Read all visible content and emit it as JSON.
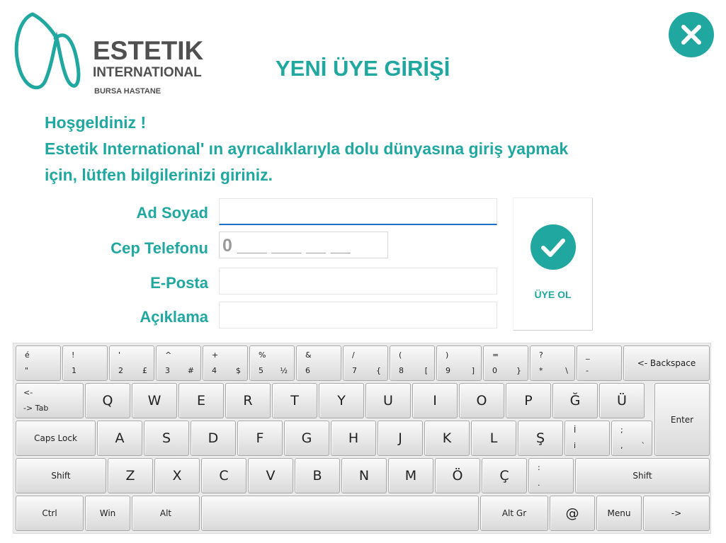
{
  "brand": {
    "name": "ESTETIK",
    "subtitle": "INTERNATIONAL",
    "location": "BURSA HASTANE"
  },
  "page_title": "YENİ ÜYE GİRİŞİ",
  "greeting": {
    "line1": "Hoşgeldiniz !",
    "line2": "Estetik International' ın ayrıcalıklarıyla dolu dünyasına giriş yapmak",
    "line3": "için, lütfen bilgilerinizi giriniz."
  },
  "form": {
    "name_label": "Ad Soyad",
    "name_value": "",
    "phone_label": "Cep Telefonu",
    "phone_mask": "0 ___ ___ __ __",
    "email_label": "E-Posta",
    "email_value": "",
    "desc_label": "Açıklama",
    "desc_value": ""
  },
  "submit_label": "ÜYE OL",
  "colors": {
    "accent": "#20a8a0",
    "brand_text": "#505050",
    "focus_underline": "#1f6fc5"
  },
  "icons": {
    "close": "close-icon",
    "submit": "checkmark-icon",
    "logo": "logo-icon"
  },
  "keyboard": {
    "row1": [
      {
        "top": "é",
        "bottom": "\"",
        "alt": ""
      },
      {
        "top": "!",
        "bottom": "1",
        "alt": ""
      },
      {
        "top": "'",
        "bottom": "2",
        "alt": "£"
      },
      {
        "top": "^",
        "bottom": "3",
        "alt": "#"
      },
      {
        "top": "+",
        "bottom": "4",
        "alt": "$"
      },
      {
        "top": "%",
        "bottom": "5",
        "alt": "½"
      },
      {
        "top": "&",
        "bottom": "6",
        "alt": ""
      },
      {
        "top": "/",
        "bottom": "7",
        "alt": "{"
      },
      {
        "top": "(",
        "bottom": "8",
        "alt": "["
      },
      {
        "top": ")",
        "bottom": "9",
        "alt": "]"
      },
      {
        "top": "=",
        "bottom": "0",
        "alt": "}"
      },
      {
        "top": "?",
        "bottom": "*",
        "alt": "\\"
      },
      {
        "top": "_",
        "bottom": "-",
        "alt": ""
      }
    ],
    "backspace": "<- Backspace",
    "tab_top": "<-",
    "tab_bottom": "-> Tab",
    "row2": [
      "Q",
      "W",
      "E",
      "R",
      "T",
      "Y",
      "U",
      "I",
      "O",
      "P",
      "Ğ",
      "Ü"
    ],
    "enter": "Enter",
    "capslock": "Caps Lock",
    "row3": [
      "A",
      "S",
      "D",
      "F",
      "G",
      "H",
      "J",
      "K",
      "L",
      "Ş"
    ],
    "row3_i_top": "İ",
    "row3_i_bottom": "i",
    "row3_semi_top": ";",
    "row3_semi_bottom": ",",
    "row3_semi_alt": "`",
    "shift_left": "Shift",
    "row4": [
      "Z",
      "X",
      "C",
      "V",
      "B",
      "N",
      "M",
      "Ö",
      "Ç"
    ],
    "row4_colon_top": ":",
    "row4_colon_bottom": ".",
    "shift_right": "Shift",
    "ctrl": "Ctrl",
    "win": "Win",
    "alt": "Alt",
    "altgr": "Alt Gr",
    "at": "@",
    "menu": "Menu",
    "arrow": "->"
  }
}
